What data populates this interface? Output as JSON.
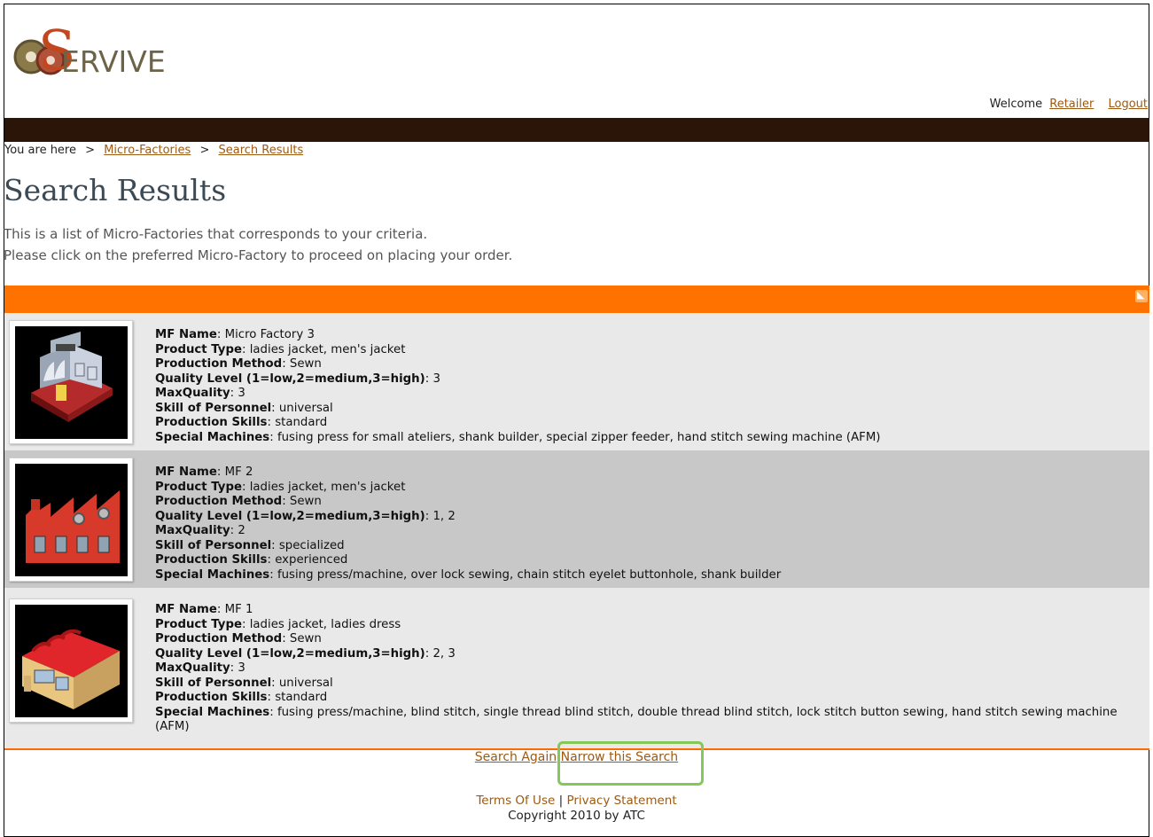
{
  "header": {
    "logo_text": "ERVIVE",
    "logo_letter": "S",
    "welcome_prefix": "Welcome",
    "user_link": "Retailer",
    "logout_link": "Logout"
  },
  "breadcrumb": {
    "prefix": "You are here",
    "sep": ">",
    "items": [
      "Micro-Factories",
      "Search Results"
    ]
  },
  "page": {
    "title": "Search Results",
    "intro_line1": "This is a list of Micro-Factories that corresponds to your criteria.",
    "intro_line2": "Please click on the preferred Micro-Factory to proceed on placing your order."
  },
  "labels": {
    "name": "MF Name",
    "type": "Product Type",
    "method": "Production Method",
    "quality": "Quality Level (1=low,2=medium,3=high)",
    "maxq": "MaxQuality",
    "skill": "Skill of Personnel",
    "pskills": "Production Skills",
    "machines": "Special Machines"
  },
  "results": [
    {
      "name": "Micro Factory 3",
      "type": "ladies jacket, men's jacket",
      "method": "Sewn",
      "quality": "3",
      "maxq": "3",
      "skill": "universal",
      "pskills": "standard",
      "machines": "fusing press for small ateliers, shank builder, special zipper feeder, hand stitch sewing machine (AFM)",
      "icon": "factory-building-icon"
    },
    {
      "name": "MF 2",
      "type": "ladies jacket, men's jacket",
      "method": "Sewn",
      "quality": "1, 2",
      "maxq": "2",
      "skill": "specialized",
      "pskills": "experienced",
      "machines": "fusing press/machine, over lock sewing, chain stitch eyelet buttonhole, shank builder",
      "icon": "red-factory-icon"
    },
    {
      "name": "MF 1",
      "type": "ladies jacket, ladies dress",
      "method": "Sewn",
      "quality": "2, 3",
      "maxq": "3",
      "skill": "universal",
      "pskills": "standard",
      "machines": "fusing press/machine, blind stitch, single thread blind stitch, double thread blind stitch, lock stitch button sewing, hand stitch sewing machine (AFM)",
      "icon": "warehouse-icon"
    }
  ],
  "actions": {
    "search_again": "Search Again",
    "narrow": "Narrow this Search"
  },
  "footer": {
    "terms": "Terms Of Use",
    "divider": "|",
    "privacy": "Privacy Statement",
    "copyright": "Copyright 2010 by ATC"
  },
  "colors": {
    "accent_orange": "#ff7200",
    "dark_bar": "#2b1508",
    "link": "#9c5a12",
    "highlight_green": "#86c75a"
  }
}
